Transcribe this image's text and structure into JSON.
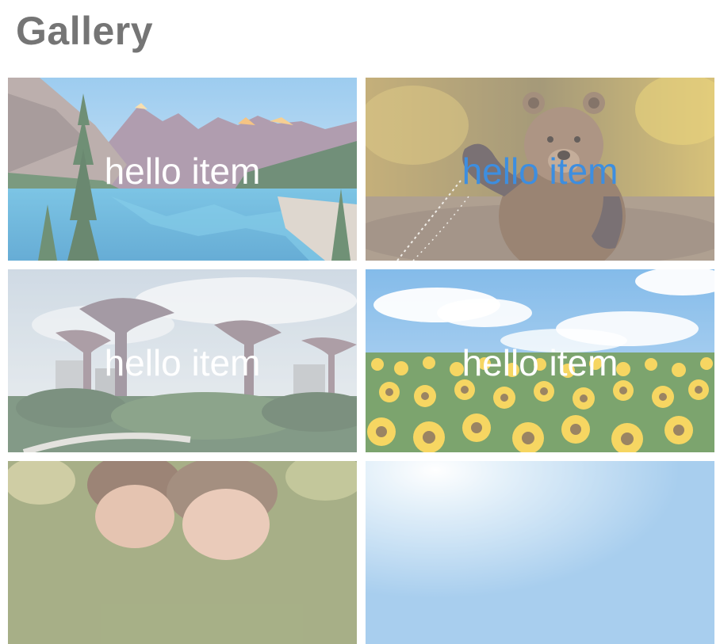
{
  "page": {
    "title": "Gallery"
  },
  "gallery": {
    "items": [
      {
        "caption": "hello item",
        "image": "mountain-lake-photo",
        "state": "default"
      },
      {
        "caption": "hello item",
        "image": "waving-bear-photo",
        "state": "hover"
      },
      {
        "caption": "hello item",
        "image": "supertree-garden-photo",
        "state": "default"
      },
      {
        "caption": "hello item",
        "image": "sunflower-field-photo",
        "state": "default"
      },
      {
        "caption": "",
        "image": "couple-photo",
        "state": "default"
      },
      {
        "caption": "",
        "image": "sky-photo",
        "state": "default"
      }
    ]
  },
  "colors": {
    "title": "#757575",
    "caption_default": "#ffffff",
    "caption_hover": "#3d8ee0"
  }
}
